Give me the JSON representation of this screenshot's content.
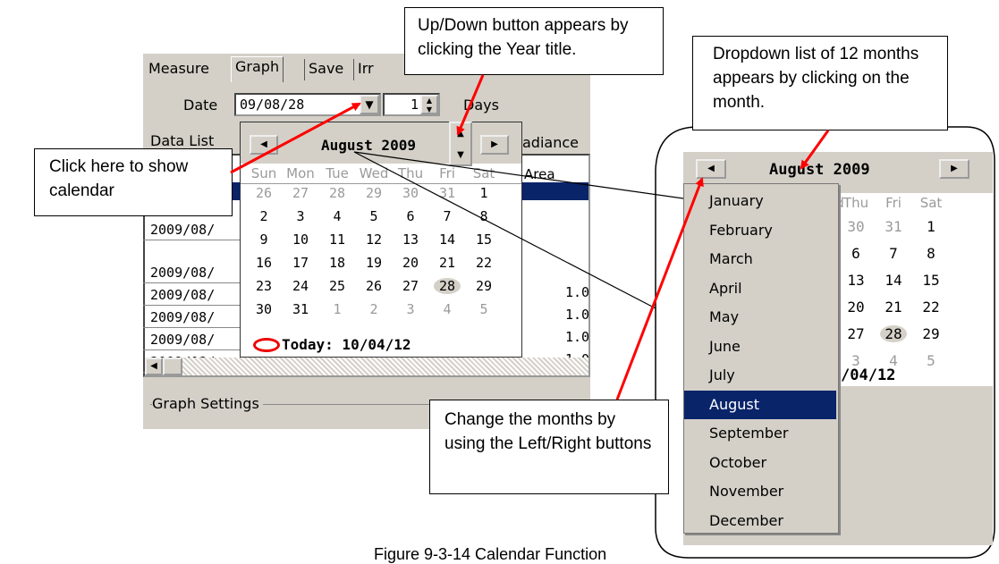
{
  "tabs": [
    "Measure",
    "Graph",
    "Save",
    "Irr"
  ],
  "date": {
    "label": "Date",
    "value": "09/08/28",
    "days_value": "1",
    "days_label": "Days"
  },
  "data_list_label": "Data List",
  "irradiance_header": "adiance",
  "area_header": "Area",
  "data_rows": [
    "2009/08/",
    "2009/08/",
    "2009/08/",
    "2009/08/",
    "2009/08/",
    "2009/08/"
  ],
  "right_values": [
    "1.0",
    "1.0",
    "1.0",
    "1.0"
  ],
  "graph_settings_label": "Graph Settings",
  "calendar": {
    "month_year": "August 2009",
    "weekdays": [
      "Sun",
      "Mon",
      "Tue",
      "Wed",
      "Thu",
      "Fri",
      "Sat"
    ],
    "weeks": [
      [
        "26",
        "27",
        "28",
        "29",
        "30",
        "31",
        "1"
      ],
      [
        "2",
        "3",
        "4",
        "5",
        "6",
        "7",
        "8"
      ],
      [
        "9",
        "10",
        "11",
        "12",
        "13",
        "14",
        "15"
      ],
      [
        "16",
        "17",
        "18",
        "19",
        "20",
        "21",
        "22"
      ],
      [
        "23",
        "24",
        "25",
        "26",
        "27",
        "28",
        "29"
      ],
      [
        "30",
        "31",
        "1",
        "2",
        "3",
        "4",
        "5"
      ]
    ],
    "today": "Today: 10/04/12",
    "selected_day": "28"
  },
  "zoom": {
    "month_year": "August 2009",
    "weekdays": [
      "d",
      "Thu",
      "Fri",
      "Sat"
    ],
    "rows": [
      [
        "30",
        "31",
        "1"
      ],
      [
        "6",
        "7",
        "8"
      ],
      [
        "13",
        "14",
        "15"
      ],
      [
        "20",
        "21",
        "22"
      ],
      [
        "27",
        "28",
        "29"
      ],
      [
        "3",
        "4",
        "5"
      ]
    ],
    "today_partial": "/04/12",
    "months": [
      "January",
      "February",
      "March",
      "April",
      "May",
      "June",
      "July",
      "August",
      "September",
      "October",
      "November",
      "December"
    ],
    "selected_month": "August"
  },
  "callouts": {
    "updown": "Up/Down button appears by clicking the Year title.",
    "dropdown": "Dropdown list of 12 months appears by clicking on the month.",
    "click_here": "Click here to show calendar",
    "change_months": "Change the months by using the Left/Right buttons"
  },
  "caption": "Figure 9-3-14  Calendar Function",
  "colors": {
    "arrow": "#ff0000",
    "selection": "#0a246a",
    "window": "#d4d0c8"
  }
}
